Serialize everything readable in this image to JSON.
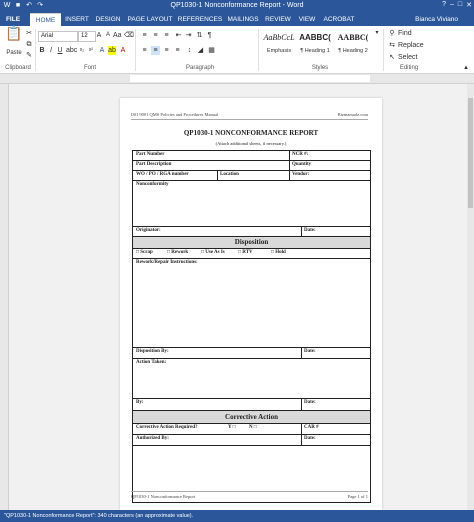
{
  "window": {
    "title": "QP1030-1 Nonconformance Report - Word"
  },
  "tabs": [
    "FILE",
    "HOME",
    "INSERT",
    "DESIGN",
    "PAGE LAYOUT",
    "REFERENCES",
    "MAILINGS",
    "REVIEW",
    "VIEW",
    "ACROBAT"
  ],
  "user": "Bianca Viviano",
  "ribbon": {
    "clipboard": {
      "paste": "Paste",
      "label": "Clipboard"
    },
    "font": {
      "name": "Arial",
      "size": "12",
      "label": "Font"
    },
    "paragraph": {
      "label": "Paragraph"
    },
    "styles": {
      "items": [
        {
          "sample": "AaBbCcL",
          "name": "Emphasis"
        },
        {
          "sample": "AABBC(",
          "name": "¶ Heading 1"
        },
        {
          "sample": "AABBC(",
          "name": "¶ Heading 2"
        }
      ],
      "label": "Styles"
    },
    "editing": {
      "find": "Find",
      "replace": "Replace",
      "select": "Select",
      "label": "Editing"
    }
  },
  "document": {
    "header_left": "ISO 9001 QMS Policies and Procedures Manual",
    "header_right": "Bizmanualz.com",
    "title": "QP1030-1 NONCONFORMANCE REPORT",
    "subtitle": "(Attach additional sheets, if necessary.)",
    "form": {
      "part_number": "Part Number",
      "ncr": "NCR #:",
      "part_description": "Part Description",
      "quantity": "Quantity",
      "wo_po_rga": "WO / PO / RGA number",
      "location": "Location",
      "vendor": "Vendor:",
      "nonconformity": "Nonconformity",
      "originator": "Originator:",
      "date": "Date:",
      "disposition": "Disposition",
      "disp_options": [
        "□ Scrap",
        "□ Rework",
        "□ Use As Is",
        "□ RTV",
        "□ Hold"
      ],
      "rework_instructions": "Rework/Repair Instructions:",
      "disposition_by": "Disposition By:",
      "action_taken": "Action Taken:",
      "by": "By:",
      "corrective_action": "Corrective Action",
      "ca_required": "Corrective Action Required?",
      "yes": "Y □",
      "no": "N □",
      "car": "CAR #",
      "authorized_by": "Authorized By:"
    },
    "footer_left": "QP1030-1 Nonconformance Report",
    "footer_right": "Page 1 of 1"
  },
  "status": "\"QP1030-1 Nonconformance Report\": 340 characters (an approximate value)."
}
